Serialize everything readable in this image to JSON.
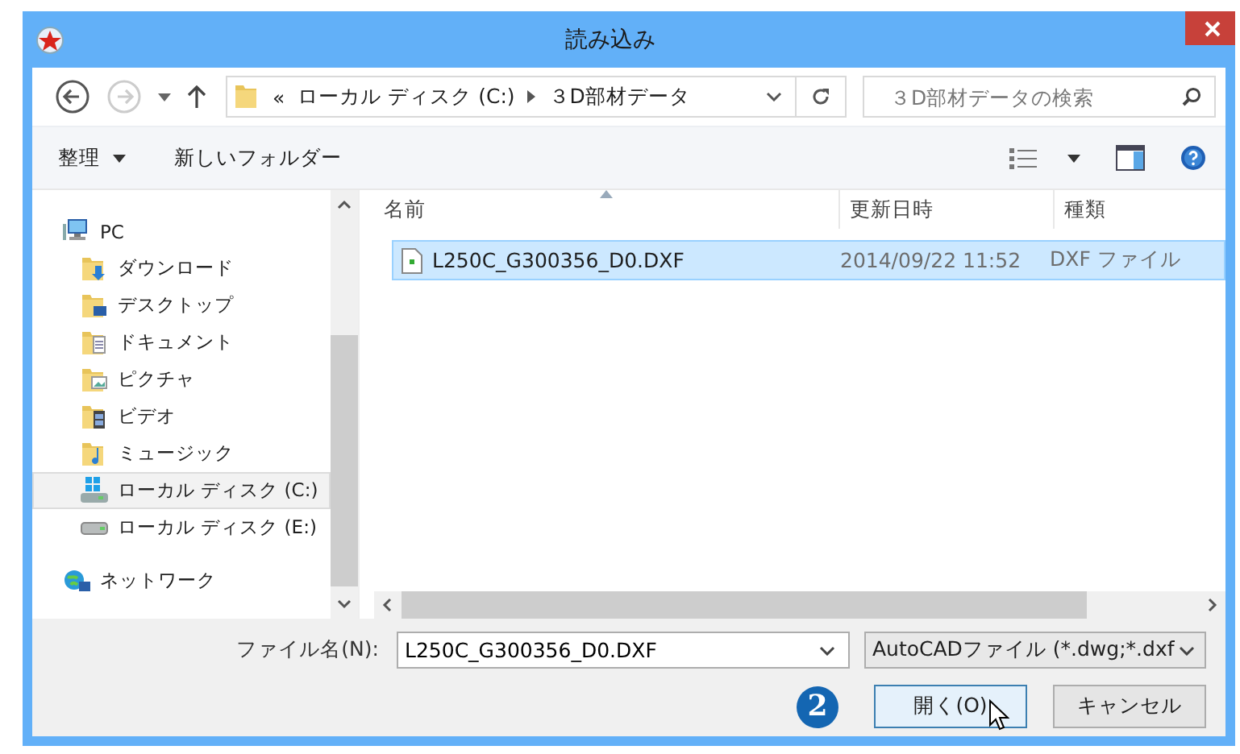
{
  "window": {
    "title": "読み込み"
  },
  "address": {
    "overflow": "«",
    "segments": [
      "ローカル ディスク (C:)",
      "３D部材データ"
    ]
  },
  "search": {
    "placeholder": "３D部材データの検索"
  },
  "toolbar": {
    "organize": "整理",
    "new_folder": "新しいフォルダー"
  },
  "nav": [
    {
      "label": "PC",
      "kind": "pc",
      "selected": false,
      "children": [
        {
          "label": "ダウンロード",
          "kind": "download",
          "selected": false
        },
        {
          "label": "デスクトップ",
          "kind": "desktop",
          "selected": false
        },
        {
          "label": "ドキュメント",
          "kind": "documents",
          "selected": false
        },
        {
          "label": "ピクチャ",
          "kind": "pictures",
          "selected": false
        },
        {
          "label": "ビデオ",
          "kind": "videos",
          "selected": false
        },
        {
          "label": "ミュージック",
          "kind": "music",
          "selected": false
        },
        {
          "label": "ローカル ディスク (C:)",
          "kind": "system-drive",
          "selected": true
        },
        {
          "label": "ローカル ディスク (E:)",
          "kind": "drive",
          "selected": false
        }
      ]
    },
    {
      "label": "ネットワーク",
      "kind": "network",
      "selected": false
    }
  ],
  "table": {
    "columns": [
      "名前",
      "更新日時",
      "種類"
    ],
    "rows": [
      {
        "name": "L250C_G300356_D0.DXF",
        "modified": "2014/09/22 11:52",
        "type": "DXF ファイル",
        "selected": true
      }
    ]
  },
  "file_name": {
    "label": "ファイル名(N):",
    "value": "L250C_G300356_D0.DXF"
  },
  "file_type": {
    "value": "AutoCADファイル (*.dwg;*.dxf"
  },
  "buttons": [
    {
      "label": "開く(O)",
      "kind": "primary"
    },
    {
      "label": "キャンセル",
      "kind": "cancel"
    }
  ],
  "step_badge": "2"
}
